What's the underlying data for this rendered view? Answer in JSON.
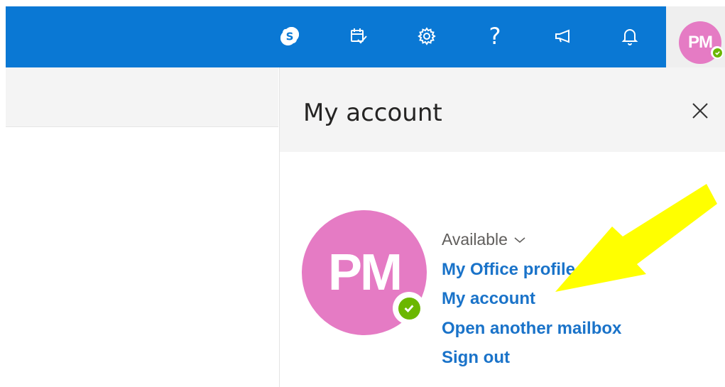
{
  "topbar": {
    "icons": [
      "skype-icon",
      "calendar-check-icon",
      "gear-icon",
      "help-icon",
      "megaphone-icon",
      "bell-icon"
    ],
    "help_glyph": "?",
    "avatar_initials": "PM",
    "accent_color": "#0a78d4"
  },
  "panel": {
    "title": "My account",
    "close_icon": "close-icon",
    "avatar_initials": "PM",
    "avatar_color": "#e57bc4",
    "presence_color": "#6bb700",
    "status": "Available",
    "links": [
      "My Office profile",
      "My account",
      "Open another mailbox",
      "Sign out"
    ],
    "link_color": "#1a73c9"
  },
  "annotation": {
    "arrow_color": "#ffff00"
  }
}
